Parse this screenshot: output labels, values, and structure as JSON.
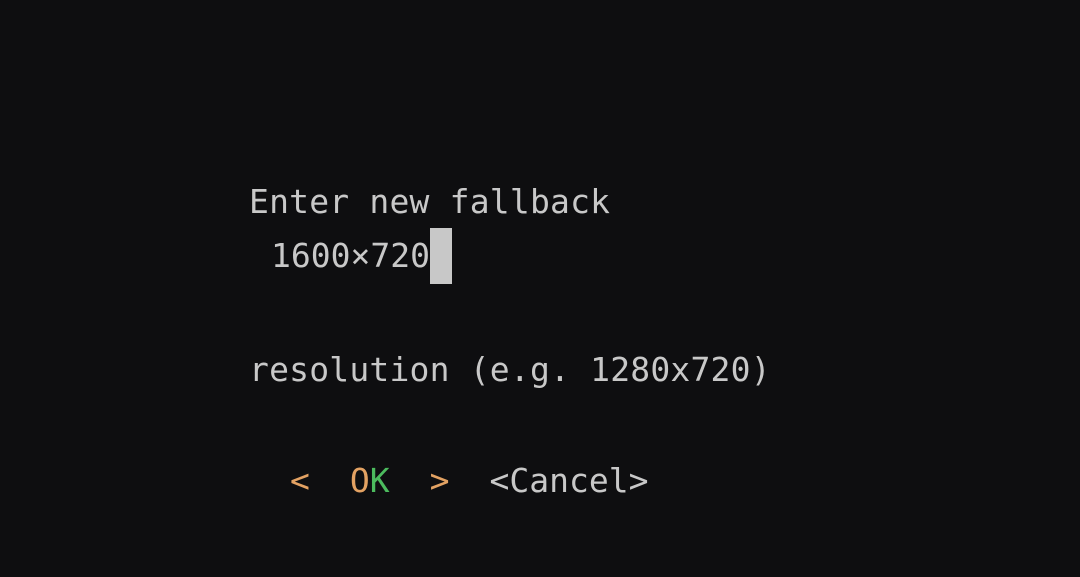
{
  "dialog": {
    "prompt_line1": "Enter new fallback",
    "prompt_line2": "resolution (e.g. 1280x720)",
    "input_value": "1600×720"
  },
  "buttons": {
    "ok_left_bracket": "<",
    "ok_o": "O",
    "ok_k": "K",
    "ok_right_bracket": ">",
    "cancel_label": "<Cancel>"
  },
  "colors": {
    "background": "#0e0e10",
    "text": "#c8c8c8",
    "accent_orange": "#e3a263",
    "hotkey_green": "#4cbb5e"
  }
}
